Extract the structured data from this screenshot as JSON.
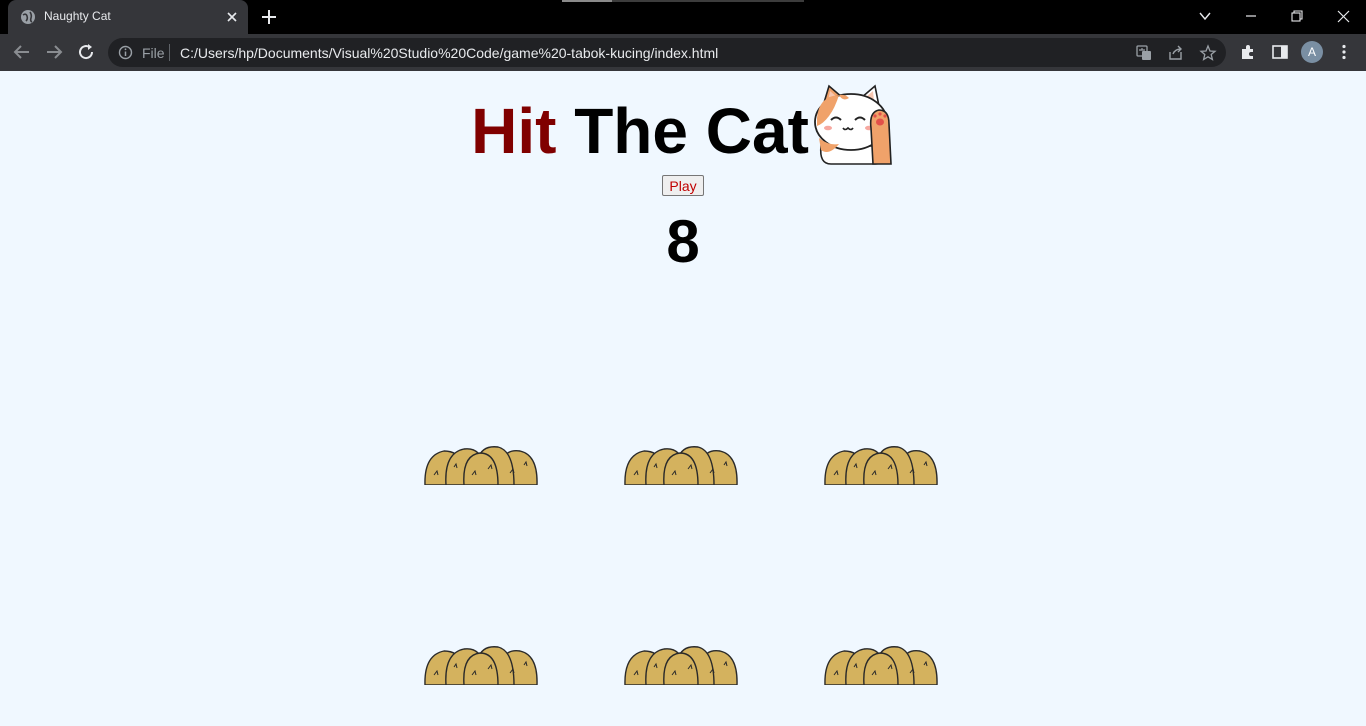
{
  "browser": {
    "tab": {
      "title": "Naughty Cat"
    },
    "address": {
      "scheme_label": "File",
      "url": "C:/Users/hp/Documents/Visual%20Studio%20Code/game%20-tabok-kucing/index.html"
    },
    "profile_initial": "A",
    "icons": [
      "globe-icon",
      "close-icon",
      "plus-icon",
      "chevron-down-icon",
      "minimize-icon",
      "restore-icon",
      "window-close-icon",
      "back-arrow-icon",
      "forward-arrow-icon",
      "reload-icon",
      "info-icon",
      "translate-icon",
      "share-icon",
      "star-icon",
      "puzzle-icon",
      "side-panel-icon",
      "more-vert-icon"
    ]
  },
  "game": {
    "title_accent": "Hit",
    "title_rest": " The Cat",
    "play_label": "Play",
    "score": "8",
    "holes": [
      1,
      2,
      3,
      4,
      5,
      6
    ],
    "colors": {
      "background": "#f0f8ff",
      "title_accent": "#800000",
      "play_text": "#c00000",
      "mound": "#d4b25e"
    }
  }
}
